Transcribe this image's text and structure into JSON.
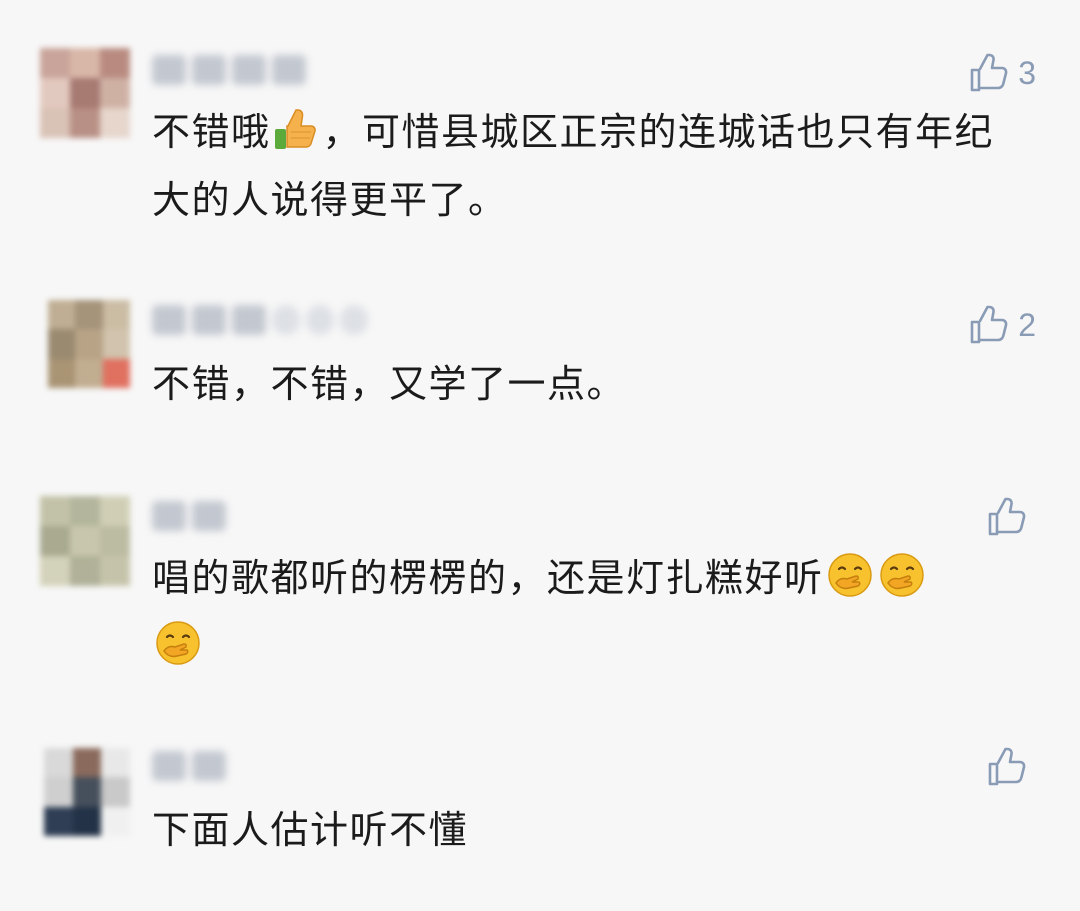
{
  "comments": [
    {
      "username": "…",
      "likes": "3",
      "text_before": "不错哦",
      "text_after": "，可惜县城区正宗的连城话也只有年纪大的人说得更平了。",
      "inline_emoji": "thumbs-up-emoji",
      "colors": {
        "avatar": [
          "#c9a49a",
          "#d8b7a8",
          "#b98b80",
          "#e2c9bf",
          "#a77a72",
          "#cfb1a4",
          "#d9c2b6",
          "#b99085",
          "#e6d6cc"
        ]
      }
    },
    {
      "username": "…",
      "likes": "2",
      "text": "不错，不错，又学了一点。",
      "colors": {
        "avatar": [
          "#bfae93",
          "#a5937a",
          "#cbbca4",
          "#9a8a70",
          "#b8a386",
          "#d1c3ad",
          "#a99474",
          "#c1ad90",
          "#e07060"
        ]
      }
    },
    {
      "username": "…",
      "likes": "",
      "text": "唱的歌都听的楞楞的，还是灯扎糕好听",
      "trailing_emoji": [
        "hand-over-mouth-emoji",
        "hand-over-mouth-emoji",
        "hand-over-mouth-emoji"
      ],
      "colors": {
        "avatar": [
          "#c2c2a8",
          "#b3b69c",
          "#d0cfb6",
          "#a9aa90",
          "#c8c7ad",
          "#bcbca2",
          "#d3d2ba",
          "#b0b198",
          "#c5c4aa"
        ]
      }
    },
    {
      "username": "…",
      "likes": "",
      "text": "下面人估计听不懂",
      "colors": {
        "avatar": [
          "#d9d9d9",
          "#8a6a5c",
          "#e8e8e8",
          "#cfcfcf",
          "#46505c",
          "#c9c9c9",
          "#2f3e55",
          "#233247",
          "#f0f0f0"
        ]
      }
    }
  ],
  "theme": {
    "background": "#f7f7f7",
    "like_color": "#8a9bb5"
  }
}
